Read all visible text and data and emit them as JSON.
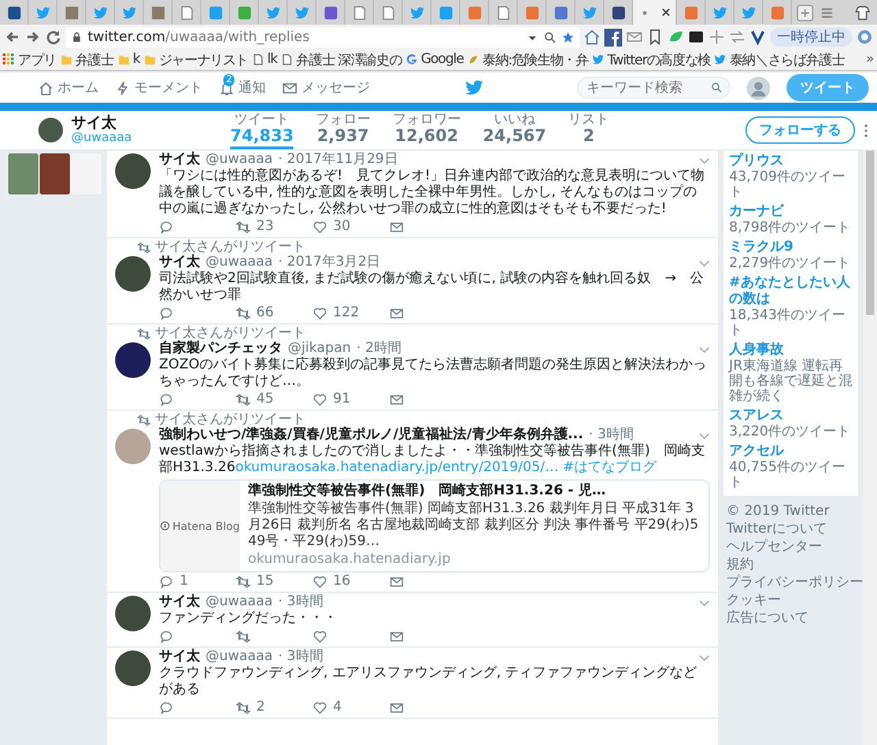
{
  "browser": {
    "tabs": [
      {
        "kind": "fav",
        "color": "#1d4f91",
        "selected": false
      },
      {
        "kind": "bird",
        "selected": false
      },
      {
        "kind": "photo",
        "selected": false
      },
      {
        "kind": "bird",
        "selected": false
      },
      {
        "kind": "bird",
        "selected": false
      },
      {
        "kind": "photo",
        "selected": false
      },
      {
        "kind": "doc",
        "selected": false
      },
      {
        "kind": "fav",
        "color": "#1da1f2",
        "selected": false
      },
      {
        "kind": "fav",
        "color": "#3cb043",
        "selected": false
      },
      {
        "kind": "bird",
        "selected": false
      },
      {
        "kind": "bird",
        "selected": false
      },
      {
        "kind": "fav",
        "color": "#6a5acd",
        "selected": false
      },
      {
        "kind": "doc",
        "selected": false
      },
      {
        "kind": "doc",
        "selected": false
      },
      {
        "kind": "bird",
        "selected": false
      },
      {
        "kind": "fav",
        "color": "#1da1f2",
        "selected": false
      },
      {
        "kind": "fav",
        "color": "#e8743b",
        "selected": false
      },
      {
        "kind": "doc",
        "selected": false
      },
      {
        "kind": "fav",
        "color": "#e8743b",
        "selected": false
      },
      {
        "kind": "fav",
        "color": "#5577cc",
        "selected": false
      },
      {
        "kind": "bird",
        "selected": false
      },
      {
        "kind": "fav",
        "color": "#334477",
        "selected": false
      },
      {
        "kind": "page",
        "selected": true
      },
      {
        "kind": "fav",
        "color": "#e8743b",
        "selected": false
      },
      {
        "kind": "bird",
        "selected": false
      },
      {
        "kind": "bird",
        "selected": false
      },
      {
        "kind": "fav",
        "color": "#e8743b",
        "selected": false
      }
    ],
    "address": {
      "host": "twitter.com",
      "path": "/uwaaaa/with_replies"
    },
    "paused_label": "一時停止中",
    "bookmarks": [
      {
        "kind": "apps",
        "label": "アプリ"
      },
      {
        "kind": "folder",
        "label": "弁護士"
      },
      {
        "kind": "folder",
        "label": "k"
      },
      {
        "kind": "folder",
        "label": "ジャーナリスト"
      },
      {
        "kind": "page",
        "label": "lk"
      },
      {
        "kind": "page",
        "label": "弁護士 深澤諭史の"
      },
      {
        "kind": "google",
        "label": "Google"
      },
      {
        "kind": "custom",
        "label": "泰納:危険生物・弁"
      },
      {
        "kind": "bird",
        "label": "Twitterの高度な検"
      },
      {
        "kind": "bird",
        "label": "泰納＼さらば弁護士"
      }
    ],
    "more": "»"
  },
  "nav": {
    "items": [
      {
        "kind": "home",
        "label": "ホーム"
      },
      {
        "kind": "moment",
        "label": "モーメント"
      },
      {
        "kind": "notify",
        "label": "通知",
        "badge": "2"
      },
      {
        "kind": "message",
        "label": "メッセージ"
      }
    ],
    "search_placeholder": "キーワード検索",
    "tweet_button": "ツイート"
  },
  "profile": {
    "name": "サイ太",
    "handle": "@uwaaaa",
    "stats": [
      {
        "label": "ツイート",
        "value": "74,833",
        "selected": true
      },
      {
        "label": "フォロー",
        "value": "2,937",
        "selected": false
      },
      {
        "label": "フォロワー",
        "value": "12,602",
        "selected": false
      },
      {
        "label": "いいね",
        "value": "24,567",
        "selected": false
      },
      {
        "label": "リスト",
        "value": "2",
        "selected": false
      }
    ],
    "follow_button": "フォローする"
  },
  "timeline": [
    {
      "name": "サイ太",
      "handle": "@uwaaaa",
      "time": "· 2017年11月29日",
      "text": "「ワシには性的意図があるぞ!　見てクレオ!」日弁連内部で政治的な意見表明について物議を醸している中, 性的な意図を表明した全裸中年男性。しかし, そんなものはコップの中の嵐に過ぎなかったし, 公然わいせつ罪の成立に性的意図はそもそも不要だった!",
      "counts": {
        "retweet": "23",
        "like": "30"
      }
    },
    {
      "retweet_label": "サイ太さんがリツイート",
      "name": "サイ太",
      "handle": "@uwaaaa",
      "time": "· 2017年3月2日",
      "text": "司法試験や2回試験直後, まだ試験の傷が癒えない頃に, 試験の内容を触れ回る奴　→　公然かいせつ罪",
      "counts": {
        "retweet": "66",
        "like": "122"
      }
    },
    {
      "retweet_label": "サイ太さんがリツイート",
      "name": "自家製パンチェッタ",
      "handle": "@jikapan",
      "time": "· 2時間",
      "text": "ZOZOのバイト募集に応募殺到の記事見てたら法曹志願者問題の発生原因と解決法わかっちゃったんですけど…。",
      "counts": {
        "retweet": "45",
        "like": "91"
      }
    },
    {
      "retweet_label": "サイ太さんがリツイート",
      "name": "強制わいせつ/準強姦/買春/児童ポルノ/児童福祉法/青少年条例弁護...",
      "time": "· 3時間",
      "text": "westlawから指摘されましたので消しましたよ・・準強制性交等被告事件(無罪)　岡崎支部H31.3.26",
      "link": "okumuraosaka.hatenadiary.jp/entry/2019/05/…",
      "hashtag": "#はてなブログ",
      "card": {
        "logo_text": "Hatena Blog",
        "title": "準強制性交等被告事件(無罪)　岡崎支部H31.3.26 - 児…",
        "description": "準強制性交等被告事件(無罪) 岡崎支部H31.3.26 裁判年月日 平成31年 3月26日 裁判所名 名古屋地裁岡崎支部 裁判区分 判決 事件番号 平29(わ)549号・平29(わ)59…",
        "domain": "okumuraosaka.hatenadiary.jp"
      },
      "counts": {
        "reply": "1",
        "retweet": "15",
        "like": "16"
      }
    },
    {
      "name": "サイ太",
      "handle": "@uwaaaa",
      "time": "· 3時間",
      "text": "ファンディングだった・・・"
    },
    {
      "name": "サイ太",
      "handle": "@uwaaaa",
      "time": "· 3時間",
      "text": "クラウドファウンディング, エアリスファウンディング, ティファファウンディングなどがある",
      "counts": {
        "retweet": "2",
        "like": "4"
      }
    }
  ],
  "sidebar": {
    "trends": [
      {
        "name": "プリウス",
        "detail": "43,709件のツイート"
      },
      {
        "name": "カーナビ",
        "detail": "8,798件のツイート"
      },
      {
        "name": "ミラクル9",
        "detail": "2,279件のツイート"
      },
      {
        "name": "#あなたとしたい人の数は",
        "detail": "18,343件のツイート"
      },
      {
        "name": "人身事故",
        "detail": "JR東海道線 運転再開も各線で遅延と混雑が続く"
      },
      {
        "name": "スアレス",
        "detail": "3,220件のツイート"
      },
      {
        "name": "アクセル",
        "detail": "40,755件のツイート"
      }
    ],
    "footer": [
      "© 2019 Twitter",
      "Twitterについて",
      "ヘルプセンター",
      "規約",
      "プライバシーポリシー",
      "クッキー",
      "広告について"
    ]
  }
}
